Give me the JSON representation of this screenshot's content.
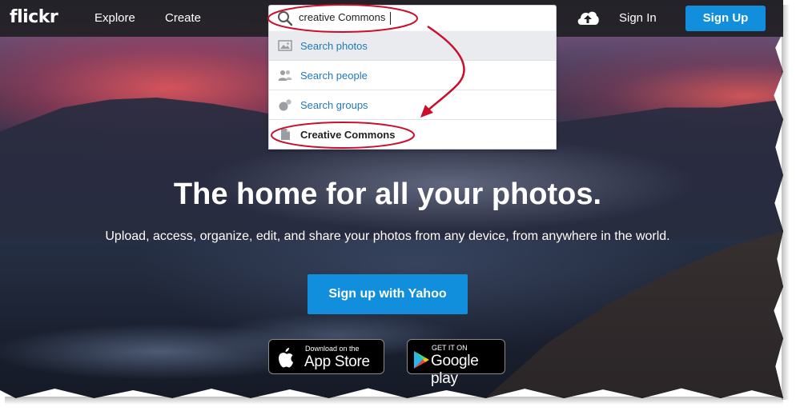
{
  "nav": {
    "logo": "flickr",
    "explore": "Explore",
    "create": "Create",
    "sign_in": "Sign In",
    "sign_up": "Sign Up"
  },
  "search": {
    "value": "creative Commons"
  },
  "dropdown": {
    "items": [
      {
        "label": "Search photos",
        "icon": "photo-icon"
      },
      {
        "label": "Search people",
        "icon": "people-icon"
      },
      {
        "label": "Search groups",
        "icon": "groups-icon"
      },
      {
        "label": "Creative Commons",
        "icon": "document-icon"
      }
    ]
  },
  "hero": {
    "headline": "The home for all your photos.",
    "subline": "Upload, access, organize, edit, and share your photos from any device, from anywhere in the world.",
    "cta": "Sign up with Yahoo"
  },
  "stores": {
    "apple_small": "Download on the",
    "apple_big": "App Store",
    "google_small": "GET IT ON",
    "google_big": "Google play"
  },
  "colors": {
    "accent": "#128fdc",
    "annotation": "#c8102e",
    "link": "#1f7ab8"
  }
}
